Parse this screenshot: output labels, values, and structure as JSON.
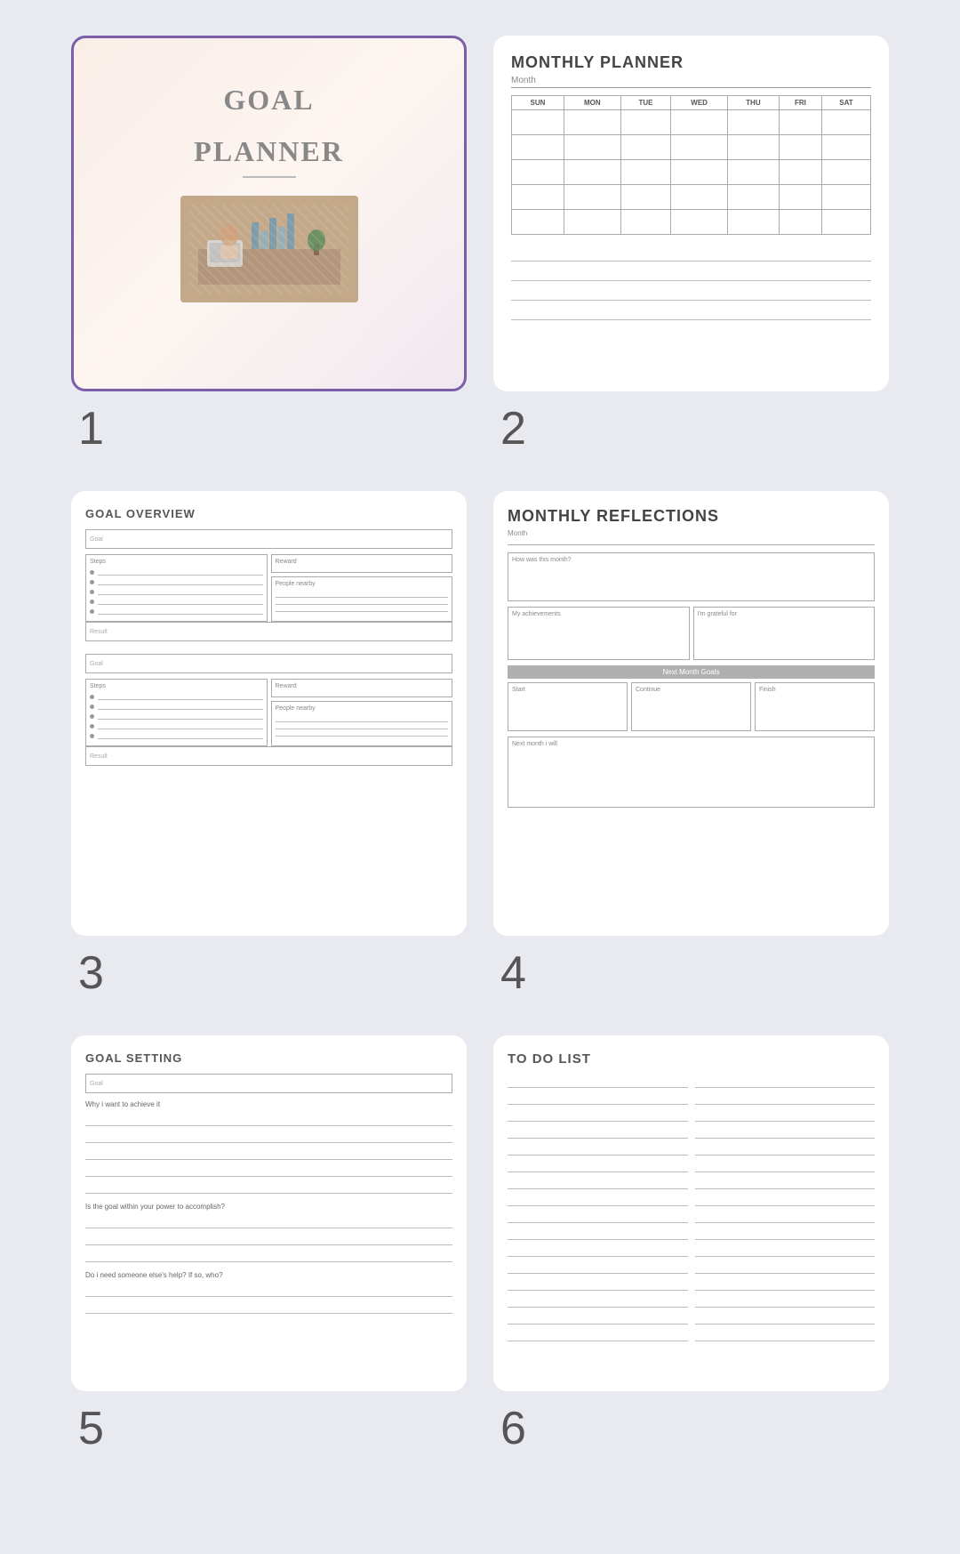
{
  "cards": [
    {
      "id": "card1",
      "number": "1",
      "type": "cover",
      "title_line1": "GOAL",
      "title_line2": "PLANNER"
    },
    {
      "id": "card2",
      "number": "2",
      "type": "monthly-planner",
      "title": "MONTHLY PLANNER",
      "month_label": "Month",
      "days": [
        "SUN",
        "MON",
        "TUE",
        "WED",
        "THU",
        "FRI",
        "SAT"
      ],
      "rows": 5,
      "note_lines": 4
    },
    {
      "id": "card3",
      "number": "3",
      "type": "goal-overview",
      "title": "GOAL OVERVIEW",
      "goal_label": "Goal",
      "steps_label": "Steps",
      "reward_label": "Reward",
      "people_label": "People nearby",
      "result_label": "Result",
      "bullet_count": 5,
      "sections": 2
    },
    {
      "id": "card4",
      "number": "4",
      "type": "monthly-reflections",
      "title": "MONTHLY REFLECTIONS",
      "month_label": "Month",
      "how_was_label": "How was this month?",
      "achievements_label": "My achievements",
      "grateful_label": "I'm grateful for",
      "next_goals_label": "Next Month Goals",
      "start_label": "Start",
      "continue_label": "Continue",
      "finish_label": "Finish",
      "next_month_label": "Next month i will"
    },
    {
      "id": "card5",
      "number": "5",
      "type": "goal-setting",
      "title": "GOAL SETTING",
      "goal_label": "Goal",
      "why_label": "Why i want to achieve it",
      "within_power_label": "Is the goal within your power to accomplish?",
      "someone_help_label": "Do i need someone else's help? If so, who?"
    },
    {
      "id": "card6",
      "number": "6",
      "type": "todo",
      "title": "TO DO LIST",
      "line_count": 16
    }
  ]
}
